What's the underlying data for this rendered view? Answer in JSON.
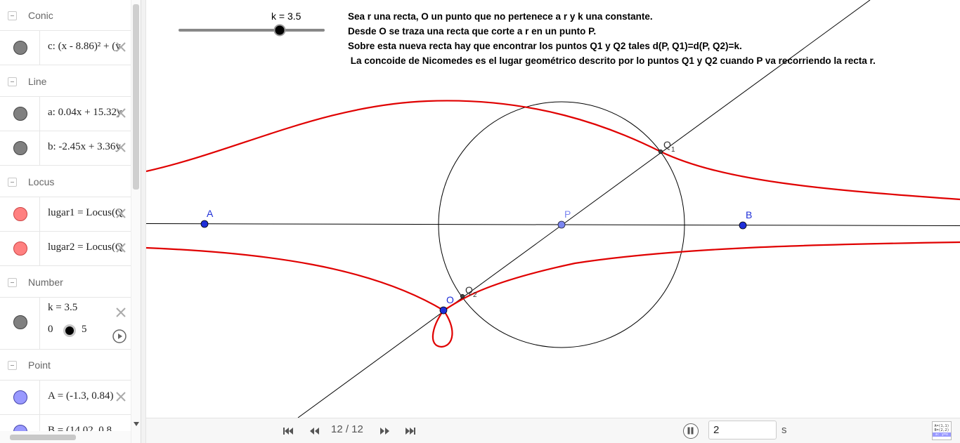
{
  "algebra": {
    "groups": [
      {
        "label": "Conic",
        "items": [
          {
            "text": "c: (x - 8.86)² + (y",
            "color": "#808080"
          }
        ]
      },
      {
        "label": "Line",
        "items": [
          {
            "text": "a: 0.04x + 15.32y",
            "color": "#808080"
          },
          {
            "text": "b: -2.45x + 3.36y",
            "color": "#808080"
          }
        ]
      },
      {
        "label": "Locus",
        "items": [
          {
            "text": "lugar1 = Locus(Q",
            "color": "#ff8080"
          },
          {
            "text": "lugar2 = Locus(Q",
            "color": "#ff8080"
          }
        ]
      },
      {
        "label": "Number",
        "items": [
          {
            "text": "k = 3.5",
            "color": "#808080",
            "min": "0",
            "max": "5"
          }
        ]
      },
      {
        "label": "Point",
        "items": [
          {
            "text": "A = (-1.3, 0.84)",
            "color": "#9999ff"
          },
          {
            "text": "B = (14.02, 0.8",
            "color": "#9999ff"
          }
        ]
      }
    ]
  },
  "graphics": {
    "slider_label": "k = 3.5",
    "k_value": 3.5,
    "k_range": [
      0,
      5
    ],
    "description": [
      "Sea r una recta, O un punto que no pertenece a r y k una constante.",
      "Desde O se traza una recta que corte a r en un punto P.",
      "Sobre esta nueva recta hay que encontrar los puntos Q1 y Q2 tales d(P, Q1)=d(P, Q2)=k.",
      " La concoide de Nicomedes es el lugar geométrico descrito por lo puntos Q1 y Q2 cuando P va recorriendo la recta r."
    ],
    "labels": {
      "A": "A",
      "B": "B",
      "P": "P",
      "O": "O",
      "Q1": "Q",
      "Q1_sub": "1",
      "Q2": "Q",
      "Q2_sub": "2"
    },
    "colors": {
      "curve": "#e00000",
      "point": "#1f2fd8",
      "point_light": "#7b86f0"
    }
  },
  "playbar": {
    "step_text": "12 / 12",
    "speed_value": "2",
    "speed_unit": "s",
    "input_help_lines": [
      "A=(1,1)",
      "B=(2,2)",
      "a: y=x"
    ]
  }
}
